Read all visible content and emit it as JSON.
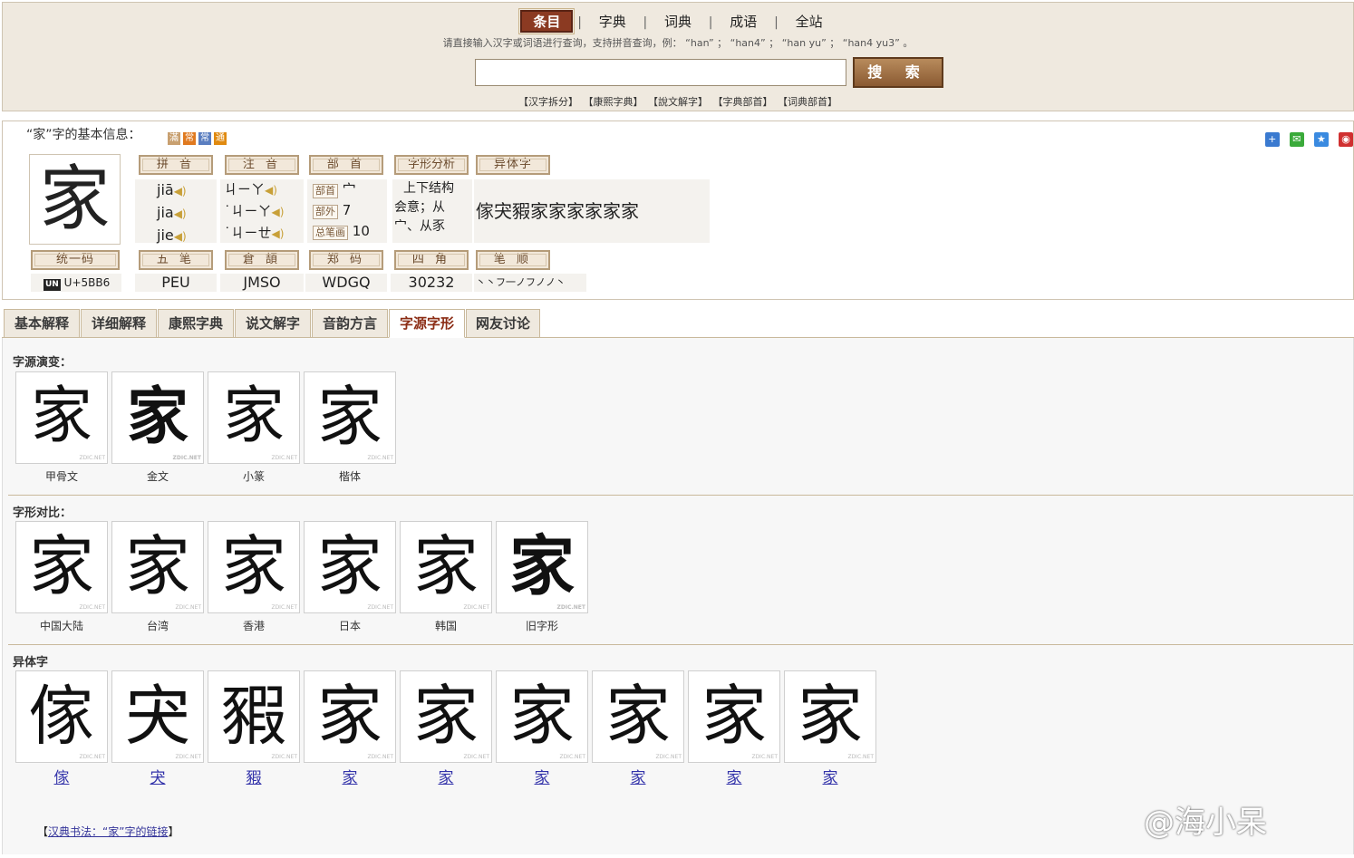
{
  "nav": {
    "items": [
      {
        "label": "条目",
        "active": true
      },
      {
        "label": "字典",
        "active": false
      },
      {
        "label": "词典",
        "active": false
      },
      {
        "label": "成语",
        "active": false
      },
      {
        "label": "全站",
        "active": false
      }
    ],
    "separator": "|"
  },
  "search": {
    "hint": "请直接输入汉字或词语进行查询，支持拼音查询，例：  “han” ；  “han4” ；  “han yu” ；  “han4 yu3” 。",
    "value": "",
    "button_label": "搜 索",
    "links": [
      "【汉字拆分】",
      "【康熙字典】",
      "【說文解字】",
      "【字典部首】",
      "【词典部首】"
    ]
  },
  "info": {
    "title": "“家”字的基本信息：",
    "badges": [
      {
        "text": "滿",
        "color": "#c8a070"
      },
      {
        "text": "常",
        "color": "#e07a20"
      },
      {
        "text": "常",
        "color": "#5a7ec0"
      },
      {
        "text": "通",
        "color": "#e08a10"
      }
    ],
    "char": "家",
    "headers": {
      "pinyin": "拼 音",
      "zhuyin": "注 音",
      "bushou": "部 首",
      "structure": "字形分析",
      "variants": "异体字",
      "unicode": "统一码",
      "wubi": "五 笔",
      "cangjie": "倉 頡",
      "zhengma": "郑 码",
      "sijiao": "四 角",
      "bishun": "笔 顺"
    },
    "pinyin": [
      "jiā",
      "jia",
      "jie"
    ],
    "zhuyin": [
      "ㄐㄧㄚ",
      "˙ㄐㄧㄚ",
      "˙ㄐㄧㄝ"
    ],
    "bushou": {
      "radical_label": "部首",
      "radical": "宀",
      "outer_label": "部外",
      "outer": "7",
      "total_label": "总笔画",
      "total": "10"
    },
    "structure": {
      "type": "上下结构",
      "desc1": "会意；从",
      "desc2": "宀、从豕"
    },
    "variant_chars": "傢宊豭家家家家家家",
    "unicode_logo": "UN",
    "unicode": "U+5BB6",
    "wubi": "PEU",
    "cangjie": "JMSO",
    "zhengma": "WDGQ",
    "sijiao": "30232",
    "bishun": "丶丶フ一ノフノノ丶"
  },
  "tabs": [
    {
      "label": "基本解释",
      "active": false
    },
    {
      "label": "详细解释",
      "active": false
    },
    {
      "label": "康熙字典",
      "active": false
    },
    {
      "label": "说文解字",
      "active": false
    },
    {
      "label": "音韵方言",
      "active": false
    },
    {
      "label": "字源字形",
      "active": true
    },
    {
      "label": "网友讨论",
      "active": false
    }
  ],
  "sections": {
    "evolution": {
      "title": "字源演变：",
      "items": [
        {
          "glyph": "家",
          "caption": "甲骨文"
        },
        {
          "glyph": "家",
          "caption": "金文"
        },
        {
          "glyph": "家",
          "caption": "小篆"
        },
        {
          "glyph": "家",
          "caption": "楷体"
        }
      ]
    },
    "compare": {
      "title": "字形对比：",
      "items": [
        {
          "glyph": "家",
          "caption": "中国大陆"
        },
        {
          "glyph": "家",
          "caption": "台湾"
        },
        {
          "glyph": "家",
          "caption": "香港"
        },
        {
          "glyph": "家",
          "caption": "日本"
        },
        {
          "glyph": "家",
          "caption": "韩国"
        },
        {
          "glyph": "家",
          "caption": "旧字形"
        }
      ]
    },
    "variants": {
      "title": "异体字",
      "items": [
        {
          "glyph": "傢",
          "caption": "傢"
        },
        {
          "glyph": "宊",
          "caption": "宊"
        },
        {
          "glyph": "豭",
          "caption": "豭"
        },
        {
          "glyph": "家",
          "caption": "家"
        },
        {
          "glyph": "家",
          "caption": "家"
        },
        {
          "glyph": "家",
          "caption": "家"
        },
        {
          "glyph": "家",
          "caption": "家"
        },
        {
          "glyph": "家",
          "caption": "家"
        },
        {
          "glyph": "家",
          "caption": "家"
        }
      ]
    }
  },
  "watermark": "ZDIC.NET",
  "footer": {
    "prefix": "【",
    "link": "汉典书法：“家”字的链接",
    "suffix": "】"
  },
  "weibo": "@海小呆"
}
